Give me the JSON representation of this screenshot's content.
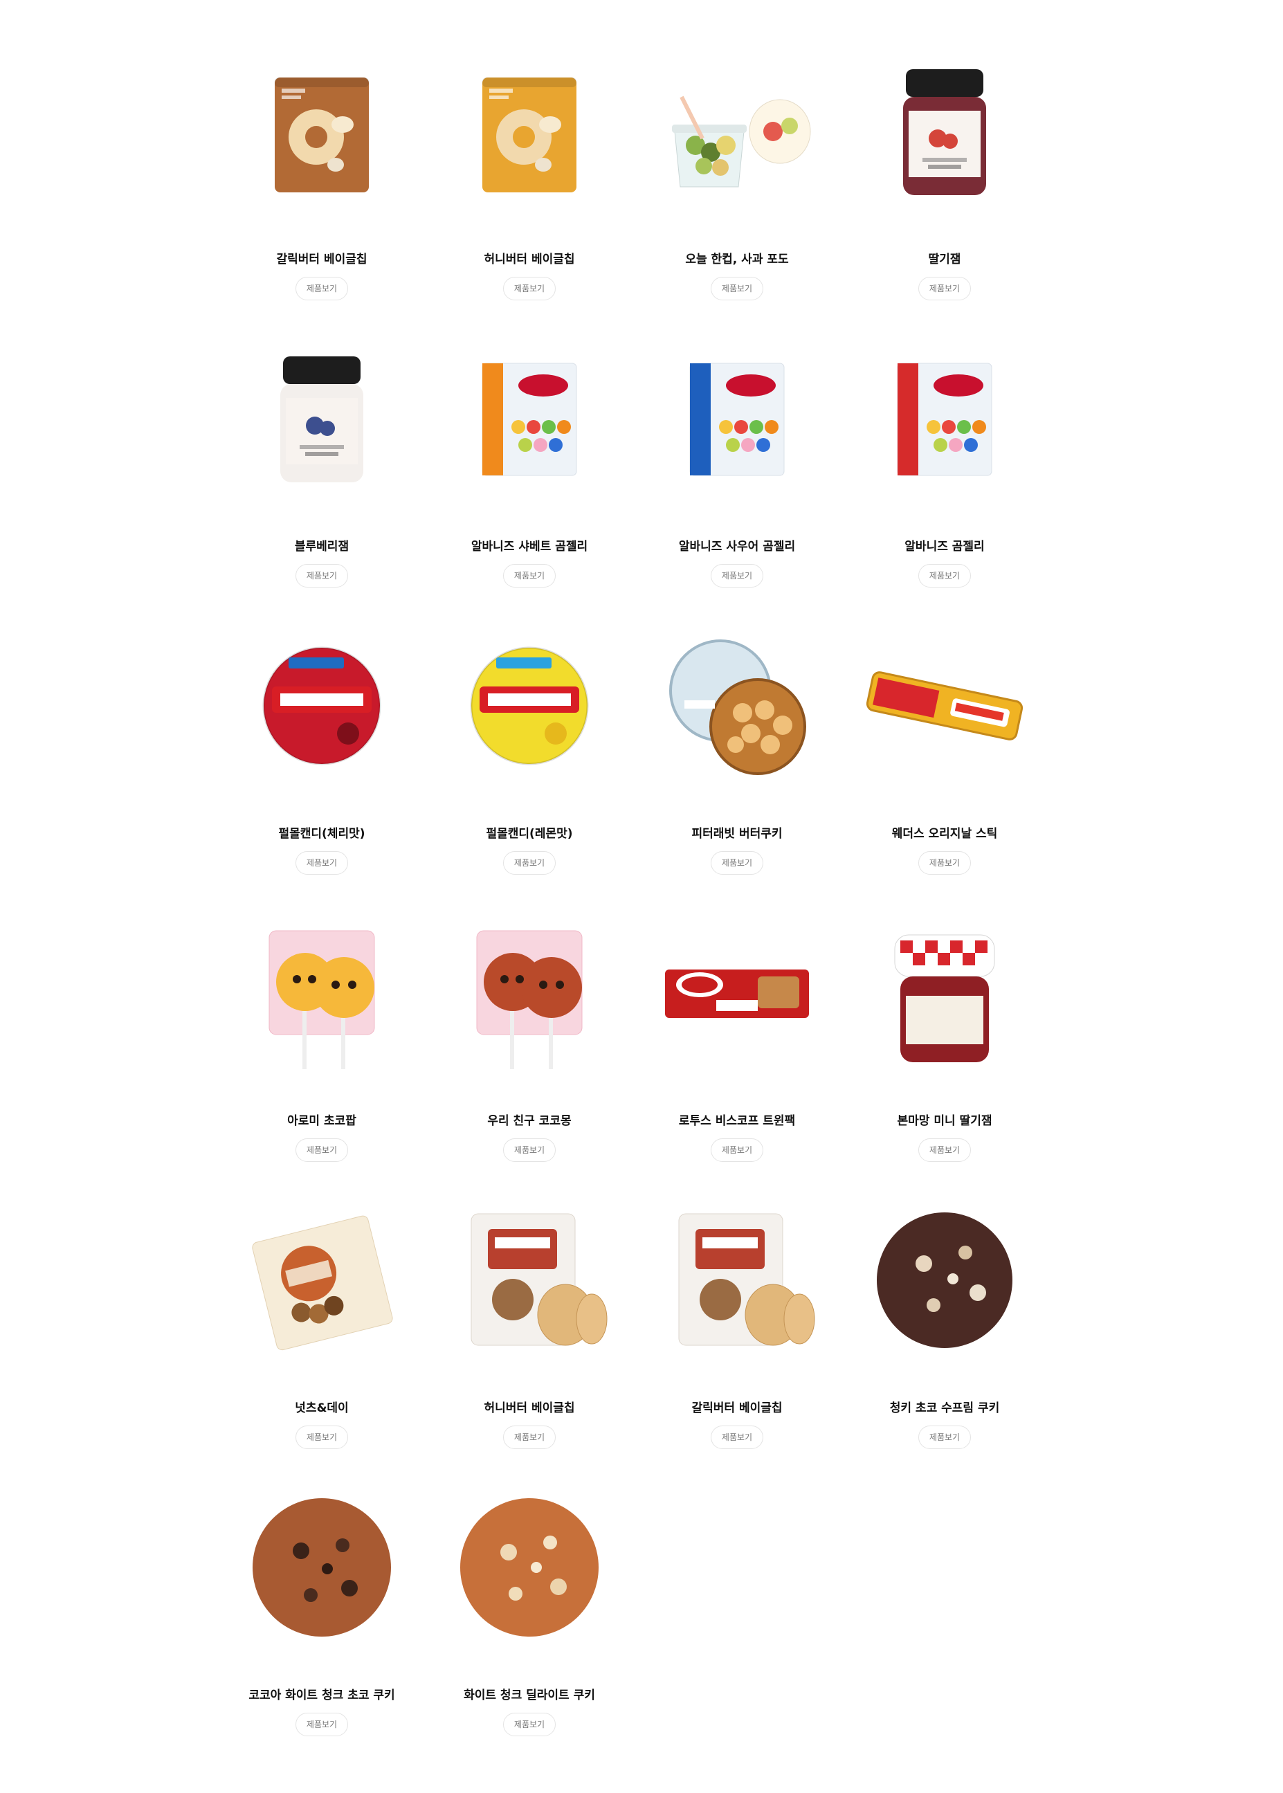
{
  "colors": {
    "background": "#ffffff",
    "name_text": "#111111",
    "button_border": "#e4e4e4",
    "button_text": "#777777"
  },
  "products": [
    {
      "name": "갈릭버터 베이글칩",
      "button": "제품보기",
      "image": "bagel-chip-pouch-brown"
    },
    {
      "name": "허니버터 베이글칩",
      "button": "제품보기",
      "image": "bagel-chip-pouch-yellow"
    },
    {
      "name": "오늘 한컵, 사과 포도",
      "button": "제품보기",
      "image": "fruit-cup"
    },
    {
      "name": "딸기잼",
      "button": "제품보기",
      "image": "jam-jar-strawberry"
    },
    {
      "name": "블루베리잼",
      "button": "제품보기",
      "image": "jam-jar-blueberry"
    },
    {
      "name": "알바니즈 샤베트 곰젤리",
      "button": "제품보기",
      "image": "gummy-bag-orange"
    },
    {
      "name": "알바니즈 사우어 곰젤리",
      "button": "제품보기",
      "image": "gummy-bag-blue"
    },
    {
      "name": "알바니즈 곰젤리",
      "button": "제품보기",
      "image": "gummy-bag-red"
    },
    {
      "name": "펄몰캔디(체리맛)",
      "button": "제품보기",
      "image": "pulmoll-tin-red"
    },
    {
      "name": "펄몰캔디(레몬맛)",
      "button": "제품보기",
      "image": "pulmoll-tin-yellow"
    },
    {
      "name": "피터래빗 버터쿠키",
      "button": "제품보기",
      "image": "cookie-tin"
    },
    {
      "name": "웨더스 오리지날 스틱",
      "button": "제품보기",
      "image": "candy-stick"
    },
    {
      "name": "아로미 초코팝",
      "button": "제품보기",
      "image": "lollipop-pink"
    },
    {
      "name": "우리 친구 코코몽",
      "button": "제품보기",
      "image": "lollipop-monkey"
    },
    {
      "name": "로투스 비스코프 트윈팩",
      "button": "제품보기",
      "image": "biscoff-pack"
    },
    {
      "name": "본마망 미니 딸기잼",
      "button": "제품보기",
      "image": "mini-jam-jar"
    },
    {
      "name": "넛츠&데이",
      "button": "제품보기",
      "image": "nuts-pouch"
    },
    {
      "name": "허니버터 베이글칩",
      "button": "제품보기",
      "image": "bagel-chip-bag-white"
    },
    {
      "name": "갈릭버터 베이글칩",
      "button": "제품보기",
      "image": "bagel-chip-bag-white-2"
    },
    {
      "name": "청키 초코 수프림 쿠키",
      "button": "제품보기",
      "image": "chocolate-cookie"
    },
    {
      "name": "코코아 화이트 청크 초코 쿠키",
      "button": "제품보기",
      "image": "cocoa-cookie"
    },
    {
      "name": "화이트 청크 딜라이트 쿠키",
      "button": "제품보기",
      "image": "white-chunk-cookie"
    }
  ]
}
